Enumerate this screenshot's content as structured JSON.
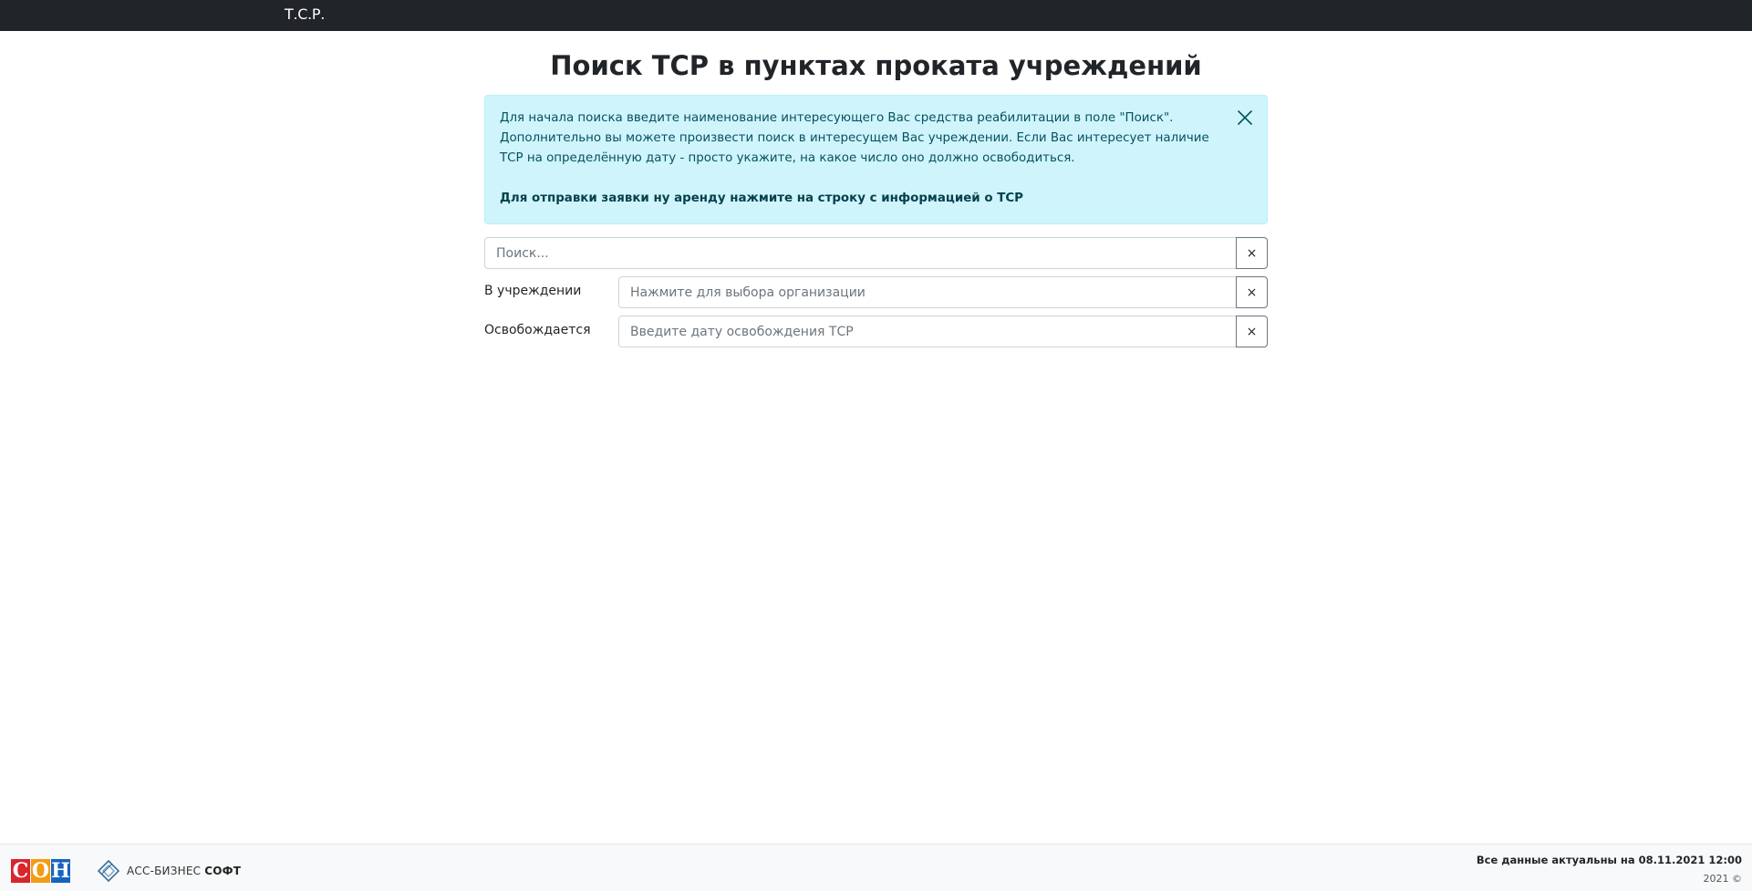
{
  "navbar": {
    "brand": "Т.С.Р."
  },
  "page": {
    "title": "Поиск ТСР в пунктах проката учреждений"
  },
  "alert": {
    "text": "Для начала поиска введите наименование интересующего Вас средства реабилитации в поле \"Поиск\". Дополнительно вы можете произвести поиск в интересущем Вас учреждении. Если Вас интересует наличие ТСР на определённую дату - просто укажите, на какое число оно должно освободиться.",
    "strong_text": "Для отправки заявки ну аренду нажмите на строку с информацией о ТСР",
    "close_icon": "close-icon"
  },
  "search": {
    "value": "",
    "placeholder": "Поиск...",
    "clear_label": "×"
  },
  "filters": {
    "organization": {
      "label": "В учреждении",
      "value": "",
      "placeholder": "Нажмите для выбора организации",
      "clear_label": "×"
    },
    "release_date": {
      "label": "Освобождается",
      "value": "",
      "placeholder": "Введите дату освобождения ТСР",
      "clear_label": "×"
    }
  },
  "footer": {
    "logo_son": {
      "letters": [
        "С",
        "О",
        "Н"
      ],
      "colors": [
        "#d8262c",
        "#f39c12",
        "#1565c0"
      ]
    },
    "logo_ass": {
      "text_light": "АСС-БИЗНЕС",
      "text_bold": "СОФТ",
      "icon": "diamond-logo-icon"
    },
    "data_actual": "Все данные актуальны на 08.11.2021 12:00",
    "copyright": "2021 ©"
  },
  "colors": {
    "navbar_bg": "#212529",
    "alert_bg": "#cff4fc",
    "alert_text": "#055160",
    "footer_bg": "#f8f9fa"
  }
}
